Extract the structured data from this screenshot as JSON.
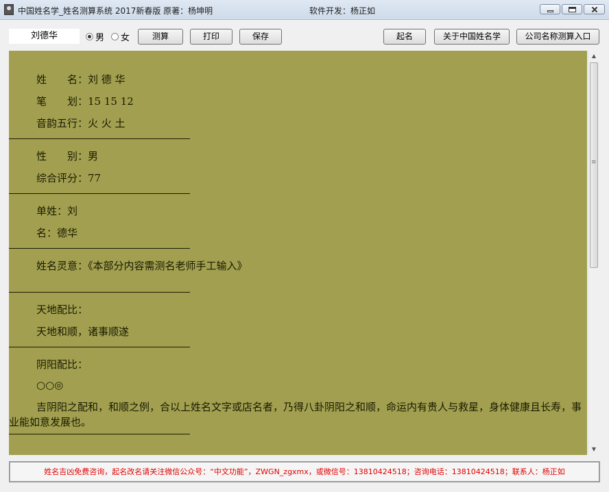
{
  "window": {
    "title": "中国姓名学_姓名测算系统 2017新春版   原著：杨坤明",
    "developer": "软件开发：杨正如"
  },
  "toolbar": {
    "name_value": "刘德华",
    "radio_male": "男",
    "radio_female": "女",
    "btn_calc": "测算",
    "btn_print": "打印",
    "btn_save": "保存",
    "btn_naming": "起名",
    "btn_about": "关于中国姓名学",
    "btn_company": "公司名称测算入口"
  },
  "report": {
    "name_line": "姓　　名：刘 德 华",
    "strokes_line": "笔　　划：15 15 12",
    "wuxing_line": "音韵五行：火 火 土",
    "gender_line": "性　　别：男",
    "score_line": "综合评分：77",
    "surname_line": "单姓：刘",
    "given_line": "名：德华",
    "lingyi_line": "姓名灵意：《本部分内容需测名老师手工输入》",
    "tiandi_title": "天地配比：",
    "tiandi_text": "天地和顺，诸事顺遂",
    "yinyang_title": "阴阳配比：",
    "yinyang_symbols": "○○◎",
    "yinyang_text": "吉阴阳之配和，和顺之例，合以上姓名文字或店名者，乃得八卦阴阳之和顺，命运内有贵人与救星，身体健康且长寿，事业能如意发展也。"
  },
  "status": {
    "text": "姓名吉凶免费咨询，起名改名请关注微信公众号：“中文功能”，ZWGN_zgxmx，或微信号：13810424518；咨询电话：13810424518；联系人：杨正如"
  },
  "colors": {
    "content_bg": "#a2a050",
    "status_text": "#e00000"
  }
}
